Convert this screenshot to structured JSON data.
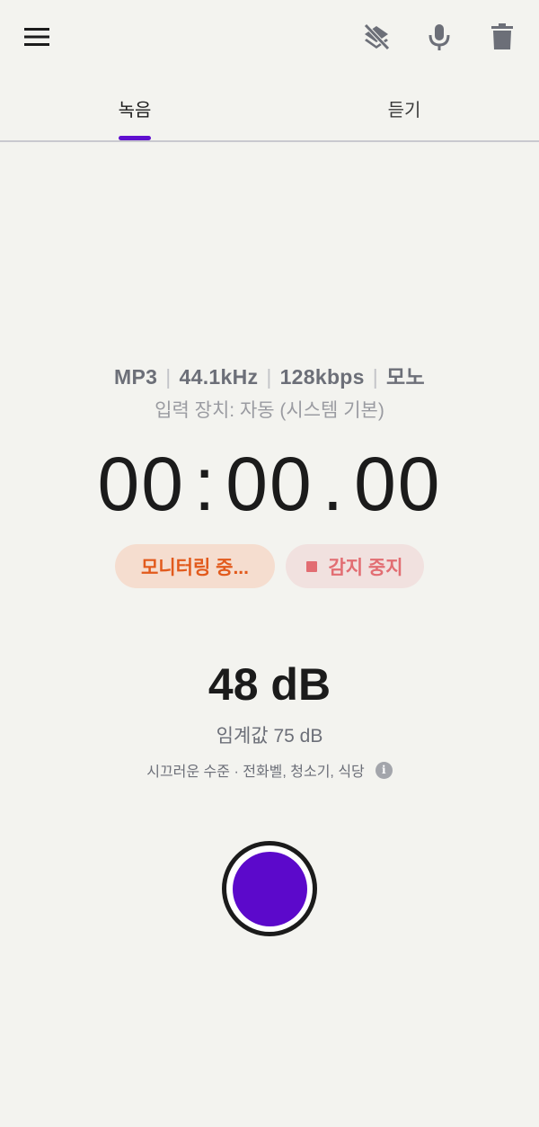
{
  "colors": {
    "background": "#f3f3ef",
    "accent": "#5f0fcf",
    "record": "#5c09cb",
    "monitor_text": "#e25a1c",
    "monitor_bg": "#f5ddcf",
    "stop_text": "#e26d72",
    "stop_bg": "#f1e1df"
  },
  "toolbar": {
    "menu_icon": "hamburger-menu-icon",
    "icons": [
      "layers-off-icon",
      "microphone-icon",
      "trash-icon"
    ]
  },
  "tabs": [
    {
      "label": "녹음",
      "selected": true
    },
    {
      "label": "듣기",
      "selected": false
    }
  ],
  "format": {
    "codec": "MP3",
    "sample_rate": "44.1kHz",
    "bitrate": "128kbps",
    "channels": "모노",
    "separator": "|"
  },
  "input_device": "입력 장치: 자동 (시스템 기본)",
  "timer": {
    "minutes": "00",
    "seconds": "00",
    "centis": "00",
    "sep1": ":",
    "sep2": "."
  },
  "status_chips": {
    "monitoring": "모니터링 중...",
    "stop_detect": "감지 중지"
  },
  "level": {
    "db_value": "48 dB",
    "threshold": "임계값 75 dB",
    "noise_description": "시끄러운 수준 · 전화벨, 청소기, 식당",
    "info_glyph": "i"
  }
}
